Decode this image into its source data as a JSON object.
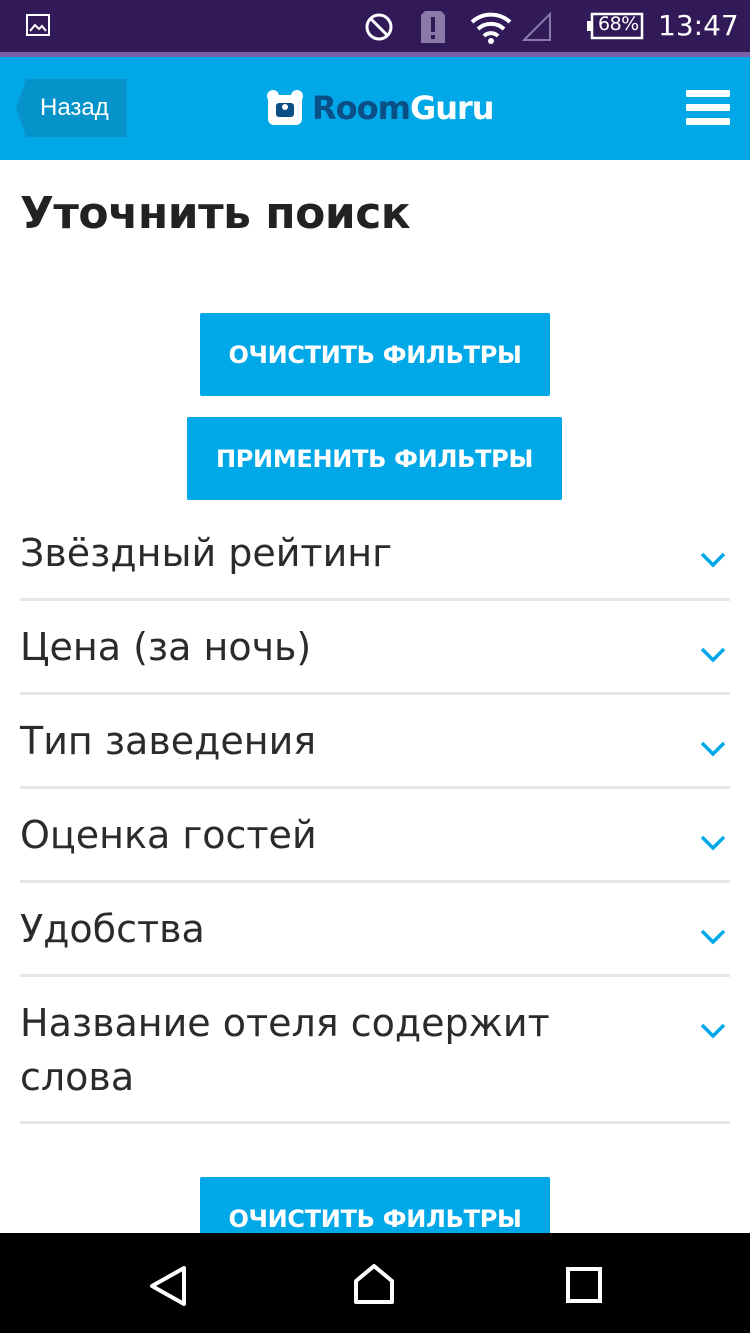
{
  "status_bar": {
    "time": "13:47",
    "battery": "68%",
    "icons": [
      "gallery-icon",
      "do-not-disturb-icon",
      "alert-icon",
      "wifi-icon",
      "signal-icon",
      "battery-icon"
    ]
  },
  "header": {
    "back_label": "Назад",
    "logo_part1": "Room",
    "logo_part2": "Guru",
    "menu_icon": "hamburger-menu-icon"
  },
  "page": {
    "title": "Уточнить поиск",
    "clear_filters": "ОЧИСТИТЬ ФИЛЬТРЫ",
    "apply_filters": "ПРИМЕНИТЬ ФИЛЬТРЫ",
    "clear_filters_bottom": "ОЧИСТИТЬ ФИЛЬТРЫ"
  },
  "filters": [
    {
      "label": "Звёздный рейтинг"
    },
    {
      "label": "Цена (за ночь)"
    },
    {
      "label": "Тип заведения"
    },
    {
      "label": "Оценка гостей"
    },
    {
      "label": "Удобства"
    },
    {
      "label": "Название отеля содержит слова"
    }
  ],
  "colors": {
    "status_bar": "#311a57",
    "brand": "#00a8e7",
    "logo_dark": "#0a4f86",
    "text": "#2b2b2b",
    "divider": "#e6e6e6"
  }
}
